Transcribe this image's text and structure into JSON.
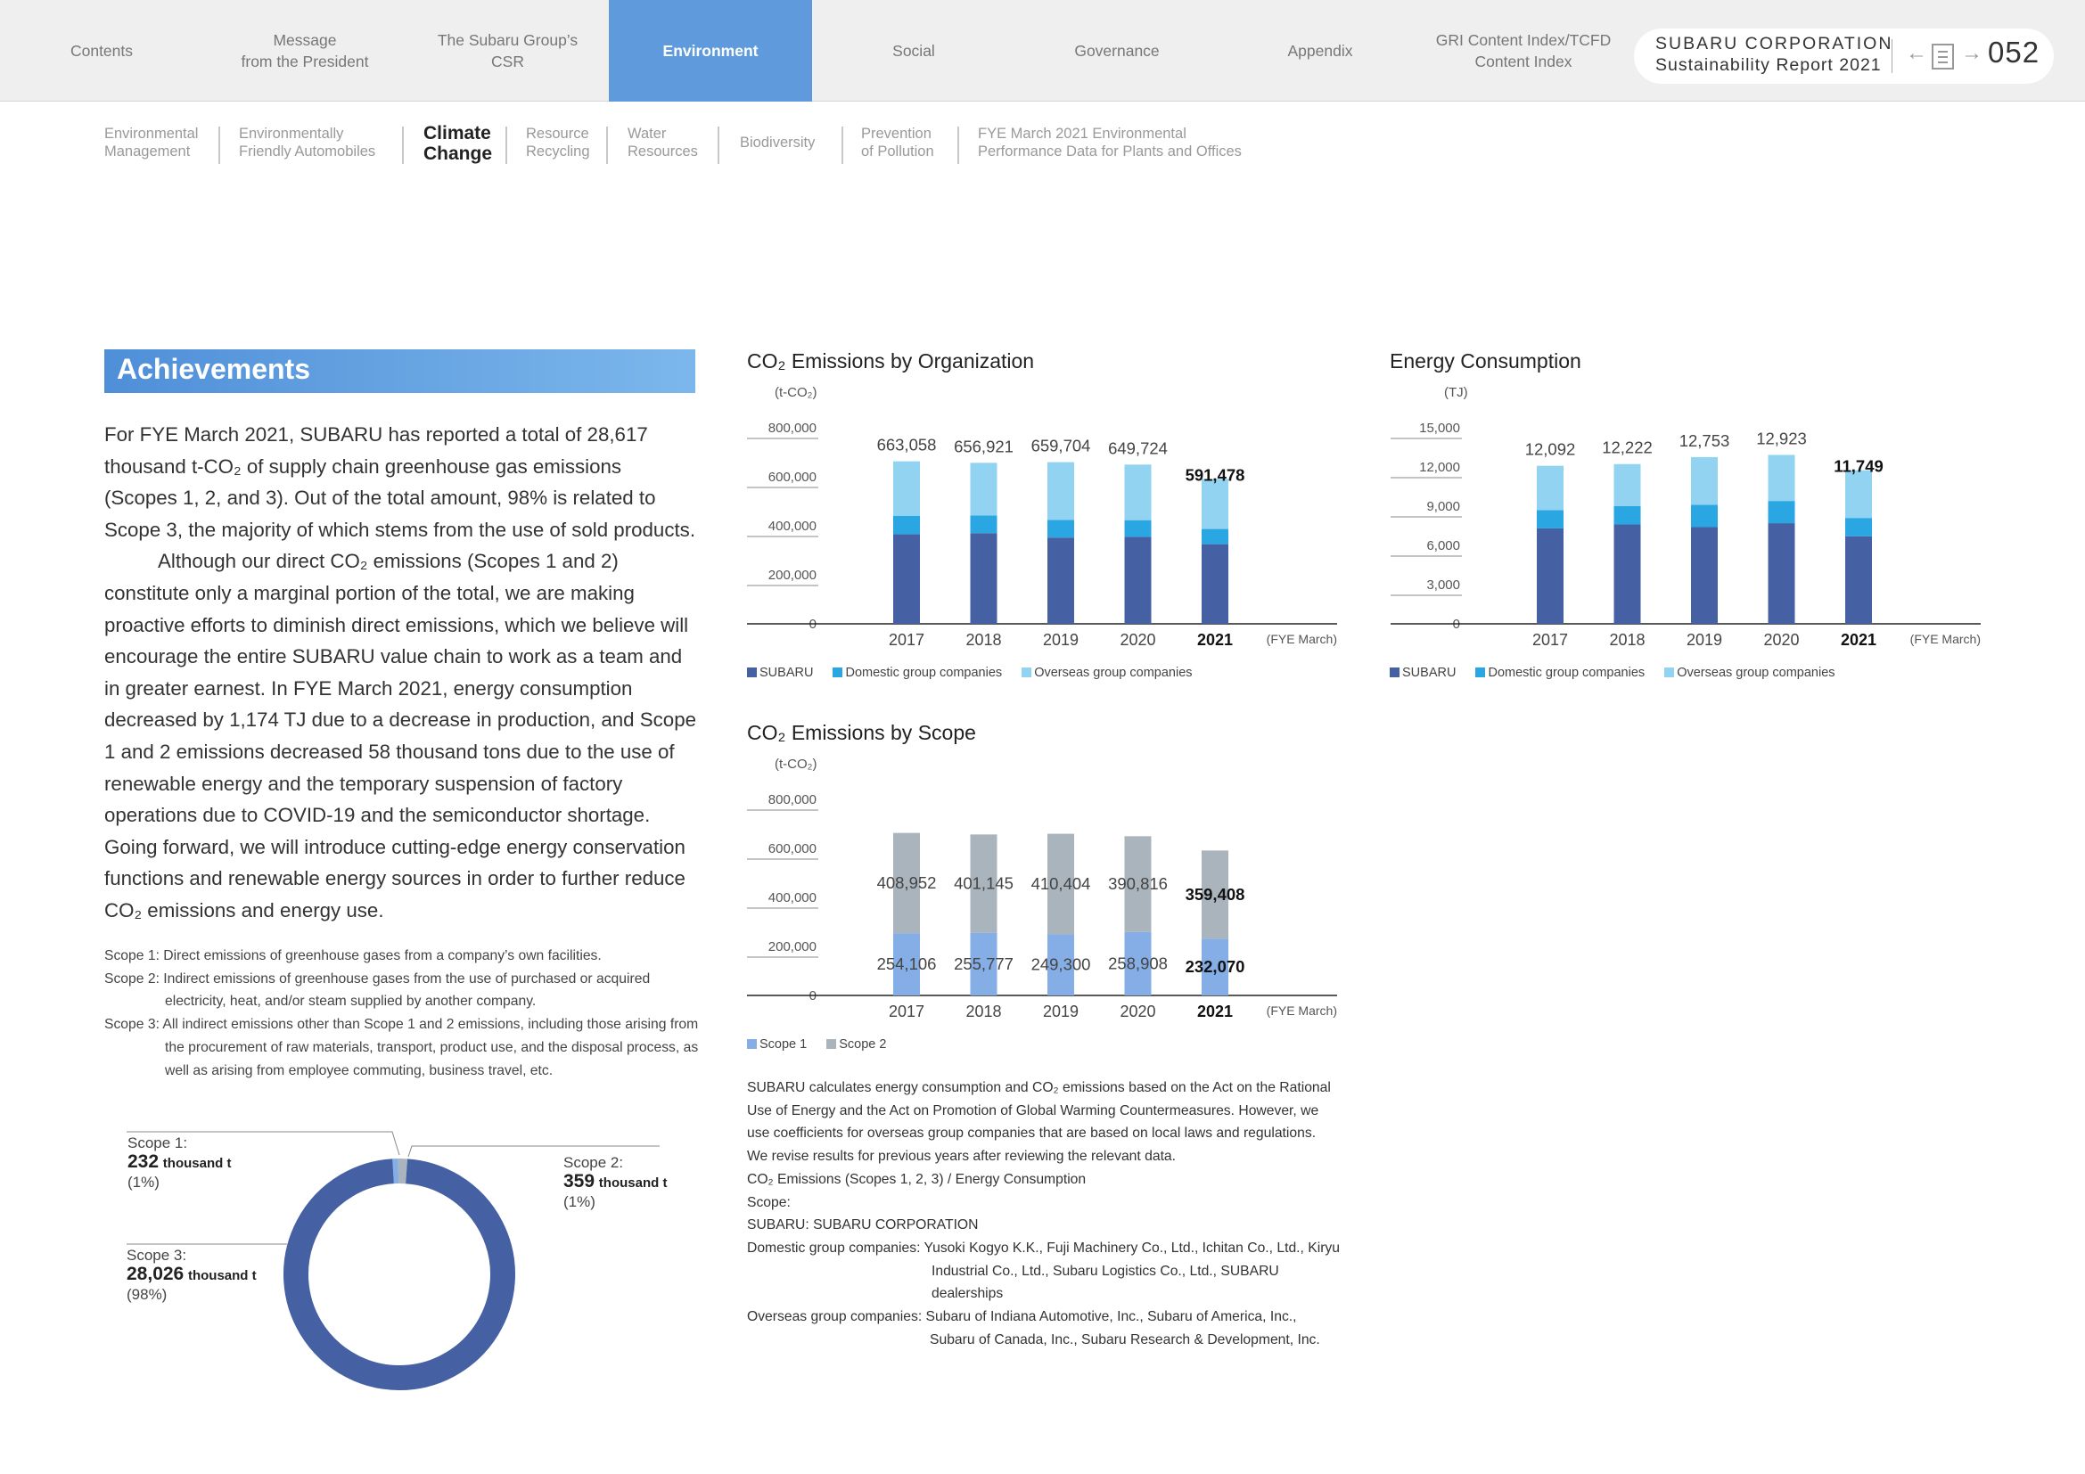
{
  "nav": {
    "tabs": [
      {
        "label": "Contents"
      },
      {
        "label": "Message\nfrom the President"
      },
      {
        "label": "The Subaru Group’s\nCSR"
      },
      {
        "label": "Environment"
      },
      {
        "label": "Social"
      },
      {
        "label": "Governance"
      },
      {
        "label": "Appendix"
      },
      {
        "label": "GRI Content Index/TCFD\nContent Index"
      }
    ],
    "company": "SUBARU CORPORATION",
    "report": "Sustainability Report 2021",
    "prev_icon": "arrow-left-icon",
    "contents_icon": "document-icon",
    "next_icon": "arrow-right-icon",
    "page_number": "052"
  },
  "subnav": {
    "items": [
      {
        "label": "Environmental\nManagement"
      },
      {
        "label": "Environmentally\nFriendly Automobiles"
      },
      {
        "label": "Climate\nChange"
      },
      {
        "label": "Resource\nRecycling"
      },
      {
        "label": "Water\nResources"
      },
      {
        "label": "Biodiversity"
      },
      {
        "label": "Prevention\nof Pollution"
      },
      {
        "label": "FYE March 2021 Environmental\nPerformance Data for Plants and Offices"
      }
    ]
  },
  "achievements": {
    "heading": "Achievements",
    "para1": "For FYE March 2021, SUBARU has reported a total of 28,617 thousand t-CO₂ of supply chain greenhouse gas emissions (Scopes 1, 2, and 3). Out of the total amount, 98% is related to Scope 3, the majority of which stems from the use of sold products.",
    "para2": "Although our direct CO₂ emissions (Scopes 1 and 2) constitute only a marginal portion of the total, we are making proactive efforts to diminish direct emissions, which we believe will encourage the entire SUBARU value chain to work as a team and in greater earnest. In FYE March 2021, energy consumption decreased by 1,174 TJ due to a decrease in production, and Scope 1 and 2 emissions decreased 58 thousand tons due to the use of renewable energy and the temporary suspension of factory operations due to COVID-19 and the semiconductor shortage. Going forward, we will introduce cutting-edge energy conservation functions and renewable energy sources in order to further reduce CO₂ emissions and energy use.",
    "scope_notes": [
      "Scope 1: Direct emissions of greenhouse gases from a company’s own facilities.",
      "Scope 2: Indirect emissions of greenhouse gases from the use of purchased or acquired electricity, heat, and/or steam supplied by another company.",
      "Scope 3: All indirect emissions other than Scope 1 and 2 emissions, including those arising from the procurement of raw materials, transport, product use, and the disposal process, as well as arising from employee commuting, business travel, etc."
    ]
  },
  "donut": {
    "labels": [
      {
        "name": "Scope 1:",
        "value": "232",
        "unit": "thousand t",
        "pct": "(1%)"
      },
      {
        "name": "Scope 2:",
        "value": "359",
        "unit": "thousand t",
        "pct": "(1%)"
      },
      {
        "name": "Scope 3:",
        "value": "28,026",
        "unit": "thousand t",
        "pct": "(98%)"
      }
    ]
  },
  "colors": {
    "subaru": "#4560a3",
    "domestic": "#2aa6e2",
    "overseas": "#92d3f2",
    "scope1": "#86aee6",
    "scope2": "#aab4bd",
    "scope3": "#4560a3"
  },
  "chart_data": [
    {
      "type": "bar",
      "stacked": true,
      "title": "CO₂ Emissions by Organization",
      "ylabel": "(t-CO₂)",
      "xlabel": "(FYE March)",
      "ylim": [
        0,
        800000
      ],
      "yticks": [
        "800,000",
        "600,000",
        "400,000",
        "200,000",
        "0"
      ],
      "categories": [
        "2017",
        "2018",
        "2019",
        "2020",
        "2021"
      ],
      "series": [
        {
          "name": "SUBARU",
          "values": [
            366000,
            370000,
            352000,
            355000,
            325000
          ]
        },
        {
          "name": "Domestic group companies",
          "values": [
            75000,
            72000,
            72000,
            68000,
            62000
          ]
        },
        {
          "name": "Overseas group companies",
          "values": [
            222058,
            214921,
            235704,
            226724,
            204478
          ]
        }
      ],
      "totals": [
        "663,058",
        "656,921",
        "659,704",
        "649,724",
        "591,478"
      ]
    },
    {
      "type": "bar",
      "stacked": true,
      "title": "Energy Consumption",
      "ylabel": "(TJ)",
      "xlabel": "(FYE March)",
      "ylim": [
        0,
        15000
      ],
      "yticks": [
        "15,000",
        "12,000",
        "9,000",
        "6,000",
        "3,000",
        "0"
      ],
      "categories": [
        "2017",
        "2018",
        "2019",
        "2020",
        "2021"
      ],
      "series": [
        {
          "name": "SUBARU",
          "values": [
            7300,
            7600,
            7400,
            7700,
            6700
          ]
        },
        {
          "name": "Domestic group companies",
          "values": [
            1400,
            1400,
            1700,
            1700,
            1400
          ]
        },
        {
          "name": "Overseas group companies",
          "values": [
            3392,
            3222,
            3653,
            3523,
            3649
          ]
        }
      ],
      "totals": [
        "12,092",
        "12,222",
        "12,753",
        "12,923",
        "11,749"
      ]
    },
    {
      "type": "bar",
      "stacked": true,
      "title": "CO₂ Emissions by Scope",
      "ylabel": "(t-CO₂)",
      "xlabel": "(FYE March)",
      "ylim": [
        0,
        800000
      ],
      "yticks": [
        "800,000",
        "600,000",
        "400,000",
        "200,000",
        "0"
      ],
      "categories": [
        "2017",
        "2018",
        "2019",
        "2020",
        "2021"
      ],
      "series": [
        {
          "name": "Scope 1",
          "values": [
            254106,
            255777,
            249300,
            258908,
            232070
          ]
        },
        {
          "name": "Scope 2",
          "values": [
            408952,
            401145,
            410404,
            390816,
            359408
          ]
        }
      ]
    }
  ],
  "notes": {
    "lines": [
      "SUBARU calculates energy consumption and CO₂ emissions based on the Act on the Rational Use of Energy and the Act on Promotion of Global Warming Countermeasures. However, we use coefficients for overseas group companies that are based on local laws and regulations. We revise results for previous years after reviewing the relevant data.",
      "CO₂ Emissions (Scopes 1, 2, 3) / Energy Consumption",
      "Scope:",
      "SUBARU: SUBARU CORPORATION",
      "Domestic group companies: Yusoki Kogyo K.K., Fuji Machinery Co., Ltd., Ichitan Co., Ltd., Kiryu Industrial Co., Ltd., Subaru Logistics Co., Ltd., SUBARU dealerships",
      "Overseas group companies: Subaru of Indiana Automotive, Inc., Subaru of America, Inc., Subaru of Canada, Inc., Subaru Research & Development, Inc."
    ]
  }
}
